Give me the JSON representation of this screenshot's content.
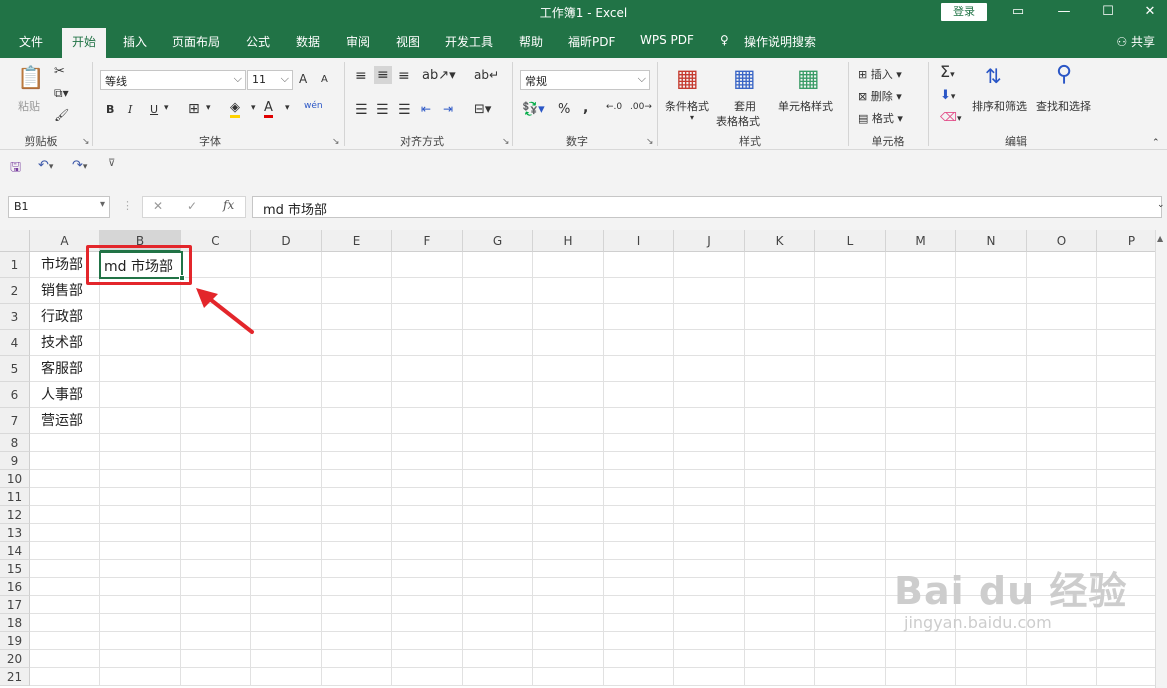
{
  "window": {
    "title": "工作簿1 - Excel",
    "login": "登录"
  },
  "tabs": [
    {
      "label": "文件"
    },
    {
      "label": "开始"
    },
    {
      "label": "插入"
    },
    {
      "label": "页面布局"
    },
    {
      "label": "公式"
    },
    {
      "label": "数据"
    },
    {
      "label": "审阅"
    },
    {
      "label": "视图"
    },
    {
      "label": "开发工具"
    },
    {
      "label": "帮助"
    },
    {
      "label": "福昕PDF"
    },
    {
      "label": "WPS PDF"
    },
    {
      "label": "操作说明搜索"
    }
  ],
  "share": "共享",
  "ribbon": {
    "clipboard": {
      "label": "剪贴板",
      "paste": "粘贴"
    },
    "font": {
      "label": "字体",
      "name": "等线",
      "size": "11",
      "bold": "B",
      "italic": "I",
      "underline": "U",
      "grow": "A",
      "shrink": "A",
      "color_letter": "A",
      "phonetic": "wén"
    },
    "align": {
      "label": "对齐方式"
    },
    "number": {
      "label": "数字",
      "format": "常规",
      "percent": "%",
      "comma": ","
    },
    "styles": {
      "label": "样式",
      "conditional": "条件格式",
      "table_line1": "套用",
      "table_line2": "表格格式",
      "cell_styles": "单元格样式"
    },
    "cells": {
      "label": "单元格",
      "insert": "插入",
      "delete": "删除",
      "format": "格式"
    },
    "editing": {
      "label": "编辑",
      "sort": "排序和筛选",
      "find": "查找和选择"
    }
  },
  "formula_bar": {
    "name_box": "B1",
    "content": "md 市场部"
  },
  "columns": [
    "A",
    "B",
    "C",
    "D",
    "E",
    "F",
    "G",
    "H",
    "I",
    "J",
    "K",
    "L",
    "M",
    "N",
    "O",
    "P"
  ],
  "rows": [
    "1",
    "2",
    "3",
    "4",
    "5",
    "6",
    "7",
    "8",
    "9",
    "10",
    "11",
    "12",
    "13",
    "14",
    "15",
    "16",
    "17",
    "18",
    "19",
    "20",
    "21"
  ],
  "cells": {
    "A1": "市场部",
    "A2": "销售部",
    "A3": "行政部",
    "A4": "技术部",
    "A5": "客服部",
    "A6": "人事部",
    "A7": "营运部",
    "B1": "md 市场部"
  },
  "watermark": {
    "text": "Bai du 经验",
    "sub": "jingyan.baidu.com"
  },
  "colors": {
    "accent": "#217346",
    "highlight": "#e3262b"
  }
}
